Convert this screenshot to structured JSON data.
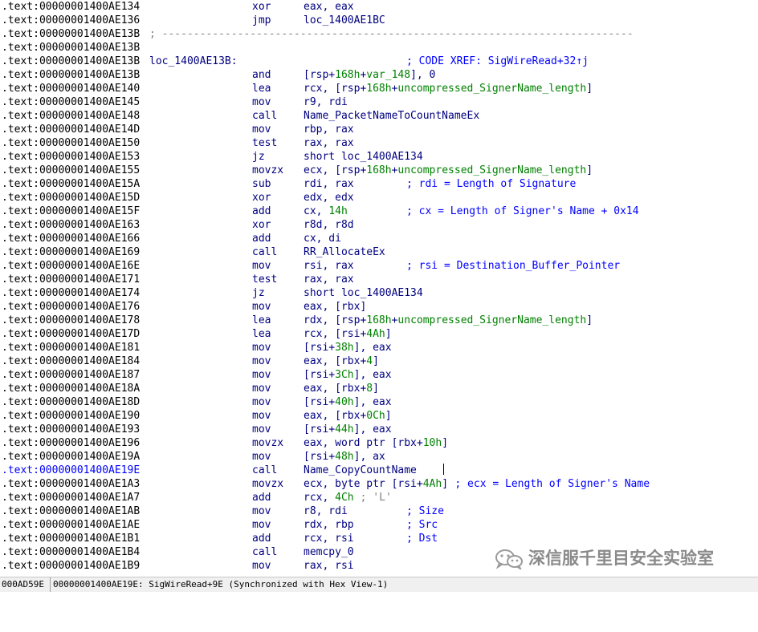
{
  "listing": [
    {
      "addr": ".text:00000001400AE134",
      "mn": "xor",
      "op": "eax, eax"
    },
    {
      "addr": ".text:00000001400AE136",
      "mn": "jmp",
      "op": "loc_1400AE1BC"
    },
    {
      "addr": ".text:00000001400AE13B",
      "sep": "; ---------------------------------------------------------------------------"
    },
    {
      "addr": ".text:00000001400AE13B"
    },
    {
      "addr": ".text:00000001400AE13B",
      "label": "loc_1400AE13B:",
      "cmt": "; CODE XREF: SigWireRead+32↑j"
    },
    {
      "addr": ".text:00000001400AE13B",
      "mn": "and",
      "op": "[rsp+168h+var_148], 0"
    },
    {
      "addr": ".text:00000001400AE140",
      "mn": "lea",
      "op": "rcx, [rsp+168h+uncompressed_SignerName_length]"
    },
    {
      "addr": ".text:00000001400AE145",
      "mn": "mov",
      "op": "r9, rdi"
    },
    {
      "addr": ".text:00000001400AE148",
      "mn": "call",
      "op": "Name_PacketNameToCountNameEx"
    },
    {
      "addr": ".text:00000001400AE14D",
      "mn": "mov",
      "op": "rbp, rax"
    },
    {
      "addr": ".text:00000001400AE150",
      "mn": "test",
      "op": "rax, rax"
    },
    {
      "addr": ".text:00000001400AE153",
      "mn": "jz",
      "op": "short loc_1400AE134"
    },
    {
      "addr": ".text:00000001400AE155",
      "mn": "movzx",
      "op": "ecx, [rsp+168h+uncompressed_SignerName_length]"
    },
    {
      "addr": ".text:00000001400AE15A",
      "mn": "sub",
      "op": "rdi, rax",
      "cmt": "; rdi = Length of Signature"
    },
    {
      "addr": ".text:00000001400AE15D",
      "mn": "xor",
      "op": "edx, edx"
    },
    {
      "addr": ".text:00000001400AE15F",
      "mn": "add",
      "op": "cx, 14h",
      "cmt": "; cx = Length of Signer's Name + 0x14"
    },
    {
      "addr": ".text:00000001400AE163",
      "mn": "xor",
      "op": "r8d, r8d"
    },
    {
      "addr": ".text:00000001400AE166",
      "mn": "add",
      "op": "cx, di"
    },
    {
      "addr": ".text:00000001400AE169",
      "mn": "call",
      "op": "RR_AllocateEx"
    },
    {
      "addr": ".text:00000001400AE16E",
      "mn": "mov",
      "op": "rsi, rax",
      "cmt": "; rsi = Destination_Buffer_Pointer"
    },
    {
      "addr": ".text:00000001400AE171",
      "mn": "test",
      "op": "rax, rax"
    },
    {
      "addr": ".text:00000001400AE174",
      "mn": "jz",
      "op": "short loc_1400AE134"
    },
    {
      "addr": ".text:00000001400AE176",
      "mn": "mov",
      "op": "eax, [rbx]"
    },
    {
      "addr": ".text:00000001400AE178",
      "mn": "lea",
      "op": "rdx, [rsp+168h+uncompressed_SignerName_length]"
    },
    {
      "addr": ".text:00000001400AE17D",
      "mn": "lea",
      "op": "rcx, [rsi+4Ah]"
    },
    {
      "addr": ".text:00000001400AE181",
      "mn": "mov",
      "op": "[rsi+38h], eax"
    },
    {
      "addr": ".text:00000001400AE184",
      "mn": "mov",
      "op": "eax, [rbx+4]"
    },
    {
      "addr": ".text:00000001400AE187",
      "mn": "mov",
      "op": "[rsi+3Ch], eax"
    },
    {
      "addr": ".text:00000001400AE18A",
      "mn": "mov",
      "op": "eax, [rbx+8]"
    },
    {
      "addr": ".text:00000001400AE18D",
      "mn": "mov",
      "op": "[rsi+40h], eax"
    },
    {
      "addr": ".text:00000001400AE190",
      "mn": "mov",
      "op": "eax, [rbx+0Ch]"
    },
    {
      "addr": ".text:00000001400AE193",
      "mn": "mov",
      "op": "[rsi+44h], eax"
    },
    {
      "addr": ".text:00000001400AE196",
      "mn": "movzx",
      "op": "eax, word ptr [rbx+10h]"
    },
    {
      "addr": ".text:00000001400AE19A",
      "mn": "mov",
      "op": "[rsi+48h], ax"
    },
    {
      "addr": ".text:00000001400AE19E",
      "mn": "call",
      "op": "Name_CopyCountName",
      "selected": true
    },
    {
      "addr": ".text:00000001400AE1A3",
      "mn": "movzx",
      "op": "ecx, byte ptr [rsi+4Ah]",
      "cmt": "; ecx = Length of Signer's Name",
      "cmt_inline": true
    },
    {
      "addr": ".text:00000001400AE1A7",
      "mn": "add",
      "op": "rcx, 4Ch",
      "cmt": "; 'L'",
      "cmt_inline": true,
      "cmt_grey": true
    },
    {
      "addr": ".text:00000001400AE1AB",
      "mn": "mov",
      "op": "r8, rdi",
      "cmt": "; Size"
    },
    {
      "addr": ".text:00000001400AE1AE",
      "mn": "mov",
      "op": "rdx, rbp",
      "cmt": "; Src"
    },
    {
      "addr": ".text:00000001400AE1B1",
      "mn": "add",
      "op": "rcx, rsi",
      "cmt": "; Dst"
    },
    {
      "addr": ".text:00000001400AE1B4",
      "mn": "call",
      "op": "memcpy_0"
    },
    {
      "addr": ".text:00000001400AE1B9",
      "mn": "mov",
      "op": "rax, rsi"
    }
  ],
  "status": {
    "offset": "000AD59E",
    "location": "00000001400AE19E: SigWireRead+9E",
    "sync": "(Synchronized with Hex View-1)"
  },
  "watermark": {
    "text": "深信服千里目安全实验室",
    "icon": "wechat-icon"
  },
  "colors": {
    "address": "#000000",
    "code": "#000080",
    "comment": "#0000ff",
    "highlight": "#008000",
    "separator": "#808080",
    "selected_address": "#0000ff",
    "statusbar_bg": "#f0f0f0"
  }
}
